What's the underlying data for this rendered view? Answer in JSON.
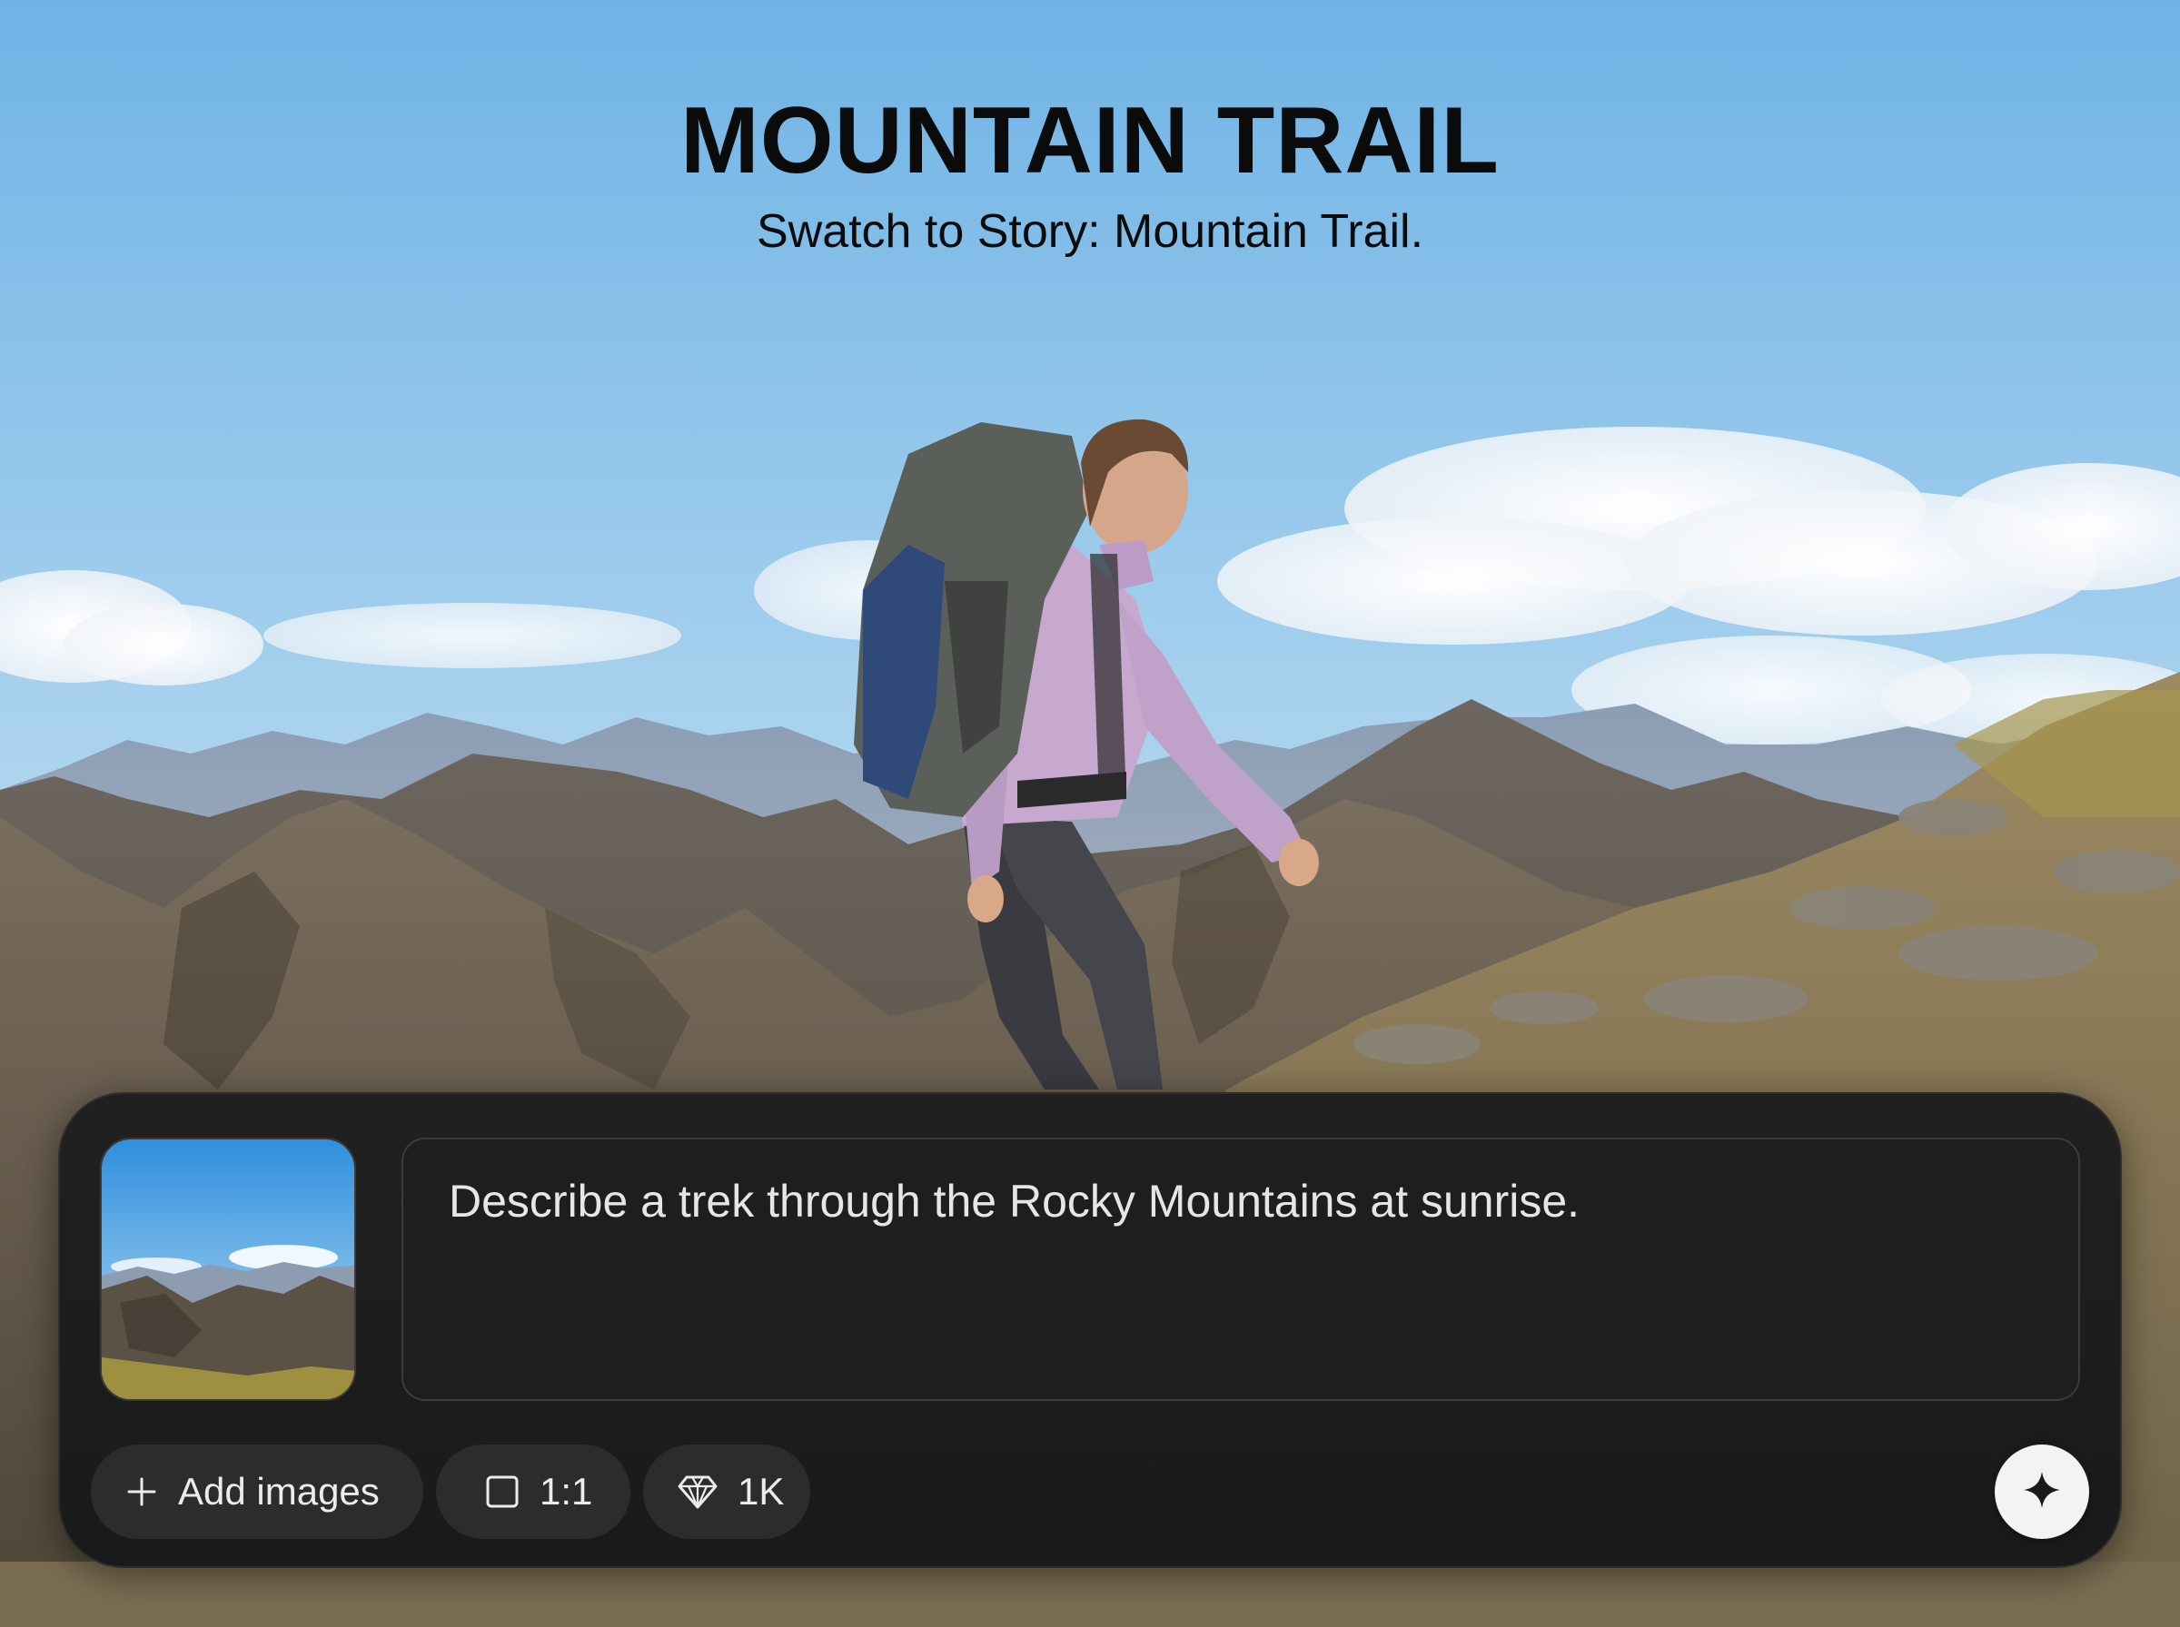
{
  "header": {
    "title": "MOUNTAIN TRAIL",
    "subtitle": "Swatch to Story: Mountain Trail."
  },
  "composer": {
    "prompt_text": "Describe a trek through the Rocky Mountains at sunrise.",
    "reference_image": {
      "icon": "mountain-landscape-thumbnail"
    },
    "chips": {
      "add_images": {
        "label": "Add images",
        "icon": "plus-icon"
      },
      "aspect_ratio": {
        "label": "1:1",
        "icon": "square-icon"
      },
      "quality": {
        "label": "1K",
        "icon": "diamond-icon"
      }
    },
    "generate_button": {
      "icon": "sparkle-icon"
    }
  },
  "colors": {
    "sky_top": "#7fbbe6",
    "composer_bg": "#1c1c1c",
    "chip_bg": "#2c2c2c",
    "text_light": "#e6e6e6",
    "button_bg": "#f3f3f3"
  }
}
